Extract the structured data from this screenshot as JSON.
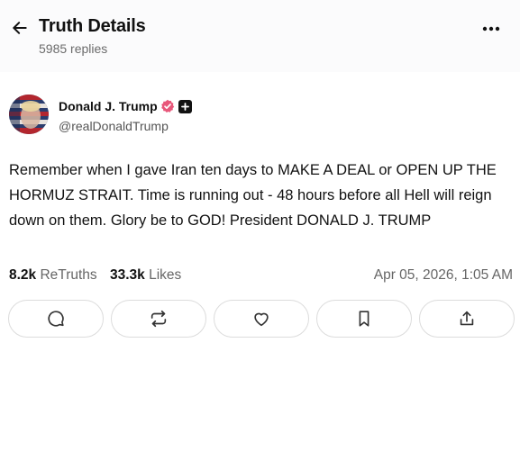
{
  "header": {
    "title": "Truth Details",
    "replies": "5985 replies",
    "icons": [
      "arrow-left-icon",
      "more-horizontal-icon"
    ]
  },
  "post": {
    "author_name": "Donald J. Trump",
    "handle": "@realDonaldTrump",
    "text": "Remember when I gave Iran ten days to MAKE A DEAL or OPEN UP THE HORMUZ STRAIT. Time is running out - 48 hours before all Hell will reign down on them. Glory be to GOD! President DONALD J. TRUMP",
    "retruths_count": "8.2k",
    "retruths_label": "ReTruths",
    "likes_count": "33.3k",
    "likes_label": "Likes",
    "timestamp": "Apr 05, 2026, 1:05 AM",
    "badge_color": "#e8577a"
  },
  "actions": [
    "reply-icon",
    "retruth-icon",
    "heart-icon",
    "bookmark-icon",
    "share-icon"
  ]
}
